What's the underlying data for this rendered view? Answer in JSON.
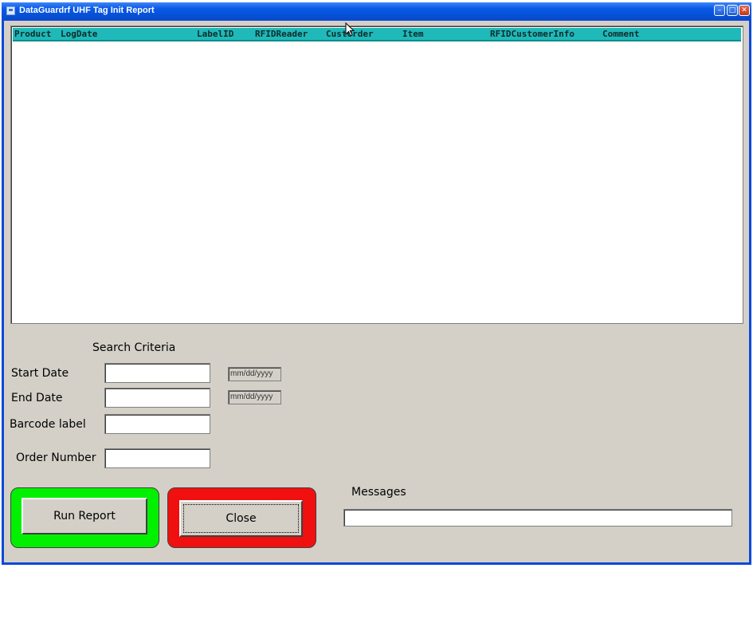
{
  "window": {
    "title": "DataGuardrf UHF Tag Init Report",
    "controls": {
      "minimize": "–",
      "maximize": "□",
      "close": "✕"
    }
  },
  "report_list": {
    "columns": [
      "Product",
      "LogDate",
      "LabelID",
      "RFIDReader",
      "CustOrder",
      "Item",
      "RFIDCustomerInfo",
      "Comment"
    ],
    "rows": []
  },
  "search": {
    "title": "Search Criteria",
    "start_date_label": "Start Date",
    "start_date_value": "",
    "start_date_hint": "mm/dd/yyyy",
    "end_date_label": "End Date",
    "end_date_value": "",
    "end_date_hint": "mm/dd/yyyy",
    "barcode_label": "Barcode label",
    "barcode_value": "",
    "order_label": "Order Number",
    "order_value": ""
  },
  "buttons": {
    "run_report": "Run Report",
    "close": "Close"
  },
  "messages": {
    "label": "Messages",
    "value": ""
  },
  "colors": {
    "header": "#1fb9b9",
    "run_frame": "#00f000",
    "close_frame": "#f01010",
    "face": "#d4d0c8",
    "titlebar": "#0a5ae8"
  }
}
